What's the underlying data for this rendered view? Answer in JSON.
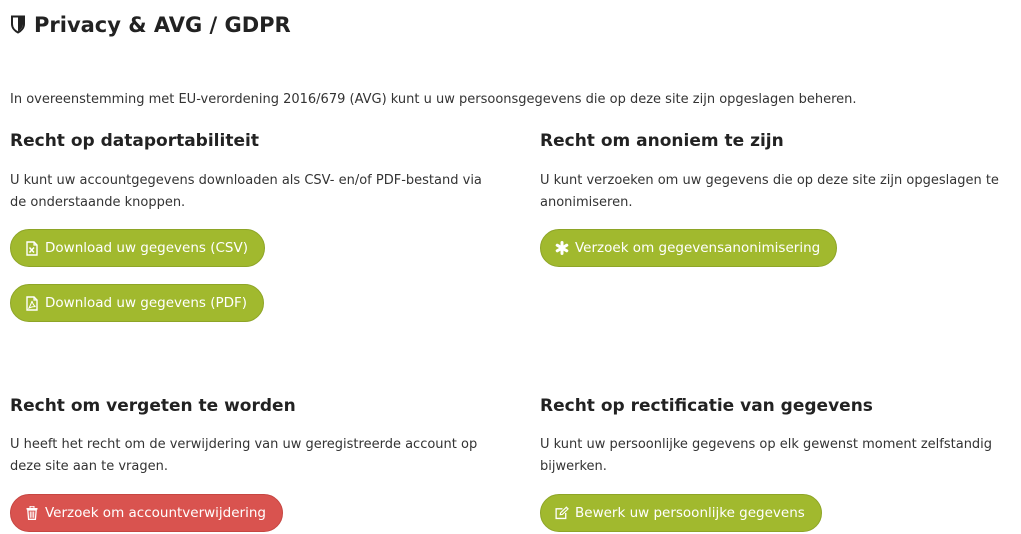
{
  "header": {
    "title": "Privacy & AVG / GDPR",
    "icon": "shield-icon"
  },
  "intro": "In overeenstemming met EU-verordening 2016/679 (AVG) kunt u uw persoonsgegevens die op deze site zijn opgeslagen beheren.",
  "sections": {
    "portability": {
      "title": "Recht op dataportabiliteit",
      "text": "U kunt uw accountgegevens downloaden als CSV- en/of PDF-bestand via de onderstaande knoppen.",
      "buttons": [
        {
          "label": "Download uw gegevens (CSV)",
          "icon": "file-excel-icon"
        },
        {
          "label": "Download uw gegevens (PDF)",
          "icon": "file-pdf-icon"
        }
      ]
    },
    "anonymity": {
      "title": "Recht om anoniem te zijn",
      "text": "U kunt verzoeken om uw gegevens die op deze site zijn opgeslagen te anonimiseren.",
      "button": {
        "label": "Verzoek om gegevensanonimisering",
        "icon": "asterisk-icon"
      }
    },
    "forgotten": {
      "title": "Recht om vergeten te worden",
      "text": "U heeft het recht om de verwijdering van uw geregistreerde account op deze site aan te vragen.",
      "button": {
        "label": "Verzoek om accountverwijdering",
        "icon": "trash-icon"
      }
    },
    "rectification": {
      "title": "Recht op rectificatie van gegevens",
      "text": "U kunt uw persoonlijke gegevens op elk gewenst moment zelfstandig bijwerken.",
      "button": {
        "label": "Bewerk uw persoonlijke gegevens",
        "icon": "edit-icon"
      }
    }
  },
  "colors": {
    "primary_button": "#a1b92e",
    "danger_button": "#d9534f",
    "text": "#333333",
    "heading": "#222222"
  }
}
